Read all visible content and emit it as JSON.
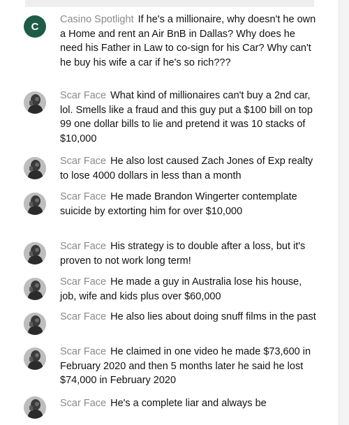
{
  "messages": [
    {
      "author": "Casino Spotlight",
      "avatar_letter": "C",
      "avatar_type": "letter",
      "text": "If he's a millionaire, why doesn't he own a Home and rent an Air BnB in Dallas? Why does he need his Father in Law to co-sign for his Car? Why can't he buy his wife a car if he's so rich???"
    },
    {
      "author": "Scar Face",
      "avatar_type": "photo",
      "text": "What kind of millionaires can't buy a 2nd car, lol. Smells like a fraud and this guy put a $100 bill on top 99 one dollar bills to lie and pretend it was 10 stacks of $10,000"
    },
    {
      "author": "Scar Face",
      "avatar_type": "photo",
      "text": "He also lost caused Zach Jones of Exp realty to lose 4000 dollars in less than a month"
    },
    {
      "author": "Scar Face",
      "avatar_type": "photo",
      "text": "He made Brandon Wingerter contemplate suicide by extorting him for over $10,000"
    },
    {
      "author": "Scar Face",
      "avatar_type": "photo",
      "text": "His strategy is to double after a loss, but it's proven to not work long term!"
    },
    {
      "author": "Scar Face",
      "avatar_type": "photo",
      "text": "He made a guy in Australia lose his house, job, wife and kids plus over $60,000"
    },
    {
      "author": "Scar Face",
      "avatar_type": "photo",
      "text": "He also lies about doing snuff films in the past"
    },
    {
      "author": "Scar Face",
      "avatar_type": "photo",
      "text": "He claimed in one video he made $73,600 in February 2020 and then 5 months later he said he lost $74,000 in February 2020"
    },
    {
      "author": "Scar Face",
      "avatar_type": "photo",
      "text": "He's a complete liar and always be"
    }
  ],
  "colors": {
    "author": "#8a8a8a",
    "text": "#111111",
    "letter_avatar_bg": "#1f5c48"
  }
}
